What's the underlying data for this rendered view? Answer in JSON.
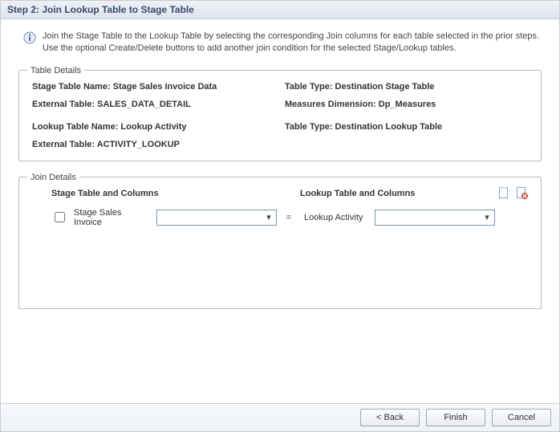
{
  "titlebar": "Step 2: Join Lookup Table to Stage Table",
  "intro": "Join the Stage Table to the Lookup Table by selecting the corresponding Join columns for each table selected in the prior steps. Use the optional Create/Delete buttons to add another join condition for the selected Stage/Lookup tables.",
  "table_details": {
    "legend": "Table Details",
    "stage_name_label": "Stage Table Name: ",
    "stage_name_value": "Stage Sales Invoice Data",
    "stage_type_label": "Table Type: ",
    "stage_type_value": "Destination Stage Table",
    "stage_ext_label": "External Table: ",
    "stage_ext_value": "SALES_DATA_DETAIL",
    "measures_label": "Measures Dimension: ",
    "measures_value": "Dp_Measures",
    "lookup_name_label": "Lookup Table Name: ",
    "lookup_name_value": "Lookup Activity",
    "lookup_type_label": "Table Type: ",
    "lookup_type_value": "Destination Lookup Table",
    "lookup_ext_label": "External Table: ",
    "lookup_ext_value": "ACTIVITY_LOOKUP"
  },
  "join_details": {
    "legend": "Join Details",
    "stage_header": "Stage Table and Columns",
    "lookup_header": "Lookup Table and Columns",
    "row": {
      "checked": false,
      "stage_table": "Stage Sales Invoice",
      "stage_column": "",
      "equals": "=",
      "lookup_table": "Lookup Activity",
      "lookup_column": ""
    },
    "icons": {
      "add": "add-join-icon",
      "delete": "delete-join-icon"
    }
  },
  "footer": {
    "back": "< Back",
    "finish": "Finish",
    "cancel": "Cancel"
  }
}
